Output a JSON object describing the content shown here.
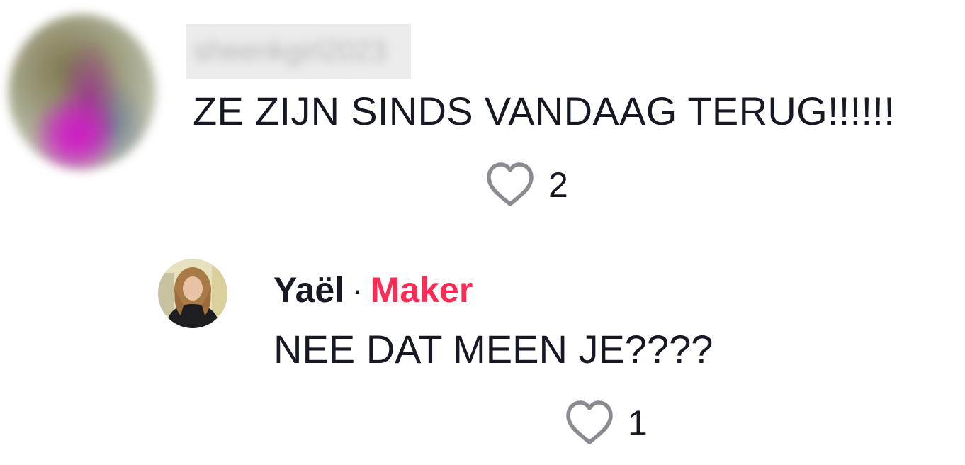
{
  "comment": {
    "username": "sheenkgirl2023",
    "text": "ZE ZIJN SINDS VANDAAG TERUG!!!!!!",
    "likes": "2"
  },
  "reply": {
    "author": "Yaël",
    "separator": "·",
    "badge": "Maker",
    "text": "NEE DAT MEEN JE????",
    "likes": "1"
  },
  "colors": {
    "text": "#161823",
    "badge": "#fe2c55",
    "icon": "#8a8b91"
  },
  "icons": {
    "like": "heart-outline-icon"
  }
}
